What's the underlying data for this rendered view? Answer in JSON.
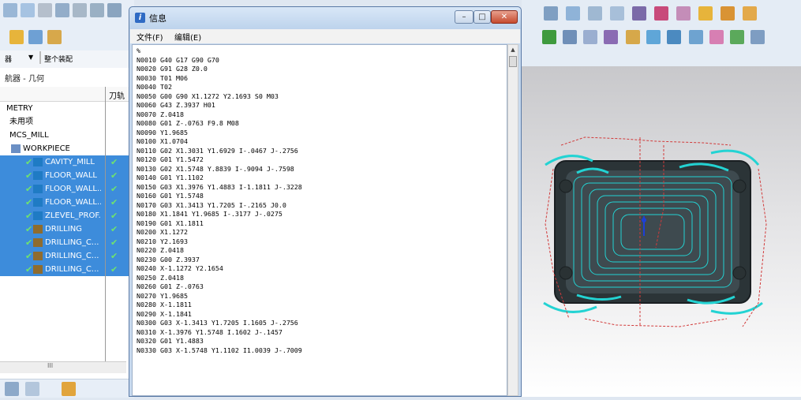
{
  "info_window": {
    "title": "信息",
    "menus": [
      "文件(F)",
      "编辑(E)"
    ],
    "buttons": {
      "minimize": "–",
      "maximize": "□",
      "close": "✕"
    },
    "code_lines": [
      "%",
      "N0010 G40 G17 G90 G70",
      "N0020 G91 G28 Z0.0",
      "N0030 T01 M06",
      "N0040 T02",
      "N0050 G00 G90 X1.1272 Y2.1693 S0 M03",
      "N0060 G43 Z.3937 H01",
      "N0070 Z.0418",
      "N0080 G01 Z-.0763 F9.8 M08",
      "N0090 Y1.9685",
      "N0100 X1.0704",
      "N0110 G02 X1.3031 Y1.6929 I-.0467 J-.2756",
      "N0120 G01 Y1.5472",
      "N0130 G02 X1.5748 Y.8839 I-.9094 J-.7598",
      "N0140 G01 Y1.1102",
      "N0150 G03 X1.3976 Y1.4883 I-1.1811 J-.3228",
      "N0160 G01 Y1.5748",
      "N0170 G03 X1.3413 Y1.7205 I-.2165 J0.0",
      "N0180 X1.1841 Y1.9685 I-.3177 J-.0275",
      "N0190 G01 X1.1811",
      "N0200 X1.1272",
      "N0210 Y2.1693",
      "N0220 Z.0418",
      "N0230 G00 Z.3937",
      "N0240 X-1.1272 Y2.1654",
      "N0250 Z.0418",
      "N0260 G01 Z-.0763",
      "N0270 Y1.9685",
      "N0280 X-1.1811",
      "N0290 X-1.1841",
      "N0300 G03 X-1.3413 Y1.7205 I.1605 J-.2756",
      "N0310 X-1.3976 Y1.5748 I.1602 J-.1457",
      "N0320 G01 Y1.4883",
      "N0330 G03 X-1.5748 Y1.1102 I1.0039 J-.7009"
    ]
  },
  "navigator": {
    "filter_left": "器",
    "filter_value": "整个装配",
    "title": "航器 - 几何",
    "column_header": "刀轨",
    "tree": [
      {
        "label": "METRY",
        "indent": 8,
        "selected": false,
        "icon": "none",
        "check": false
      },
      {
        "label": "未用项",
        "indent": 12,
        "selected": false,
        "icon": "none",
        "check": false
      },
      {
        "label": "MCS_MILL",
        "indent": 12,
        "selected": false,
        "icon": "none",
        "check": false
      },
      {
        "label": "WORKPIECE",
        "indent": 14,
        "selected": false,
        "icon": "workpiece-icon",
        "check": false
      },
      {
        "label": "CAVITY_MILL",
        "indent": 32,
        "selected": true,
        "icon": "mill-icon",
        "check": true
      },
      {
        "label": "FLOOR_WALL",
        "indent": 32,
        "selected": true,
        "icon": "mill-icon",
        "check": true
      },
      {
        "label": "FLOOR_WALL...",
        "indent": 32,
        "selected": true,
        "icon": "mill-icon",
        "check": true
      },
      {
        "label": "FLOOR_WALL...",
        "indent": 32,
        "selected": true,
        "icon": "mill-icon",
        "check": true
      },
      {
        "label": "ZLEVEL_PROF...",
        "indent": 32,
        "selected": true,
        "icon": "mill-icon",
        "check": true
      },
      {
        "label": "DRILLING",
        "indent": 32,
        "selected": true,
        "icon": "drill-icon",
        "check": true
      },
      {
        "label": "DRILLING_C...",
        "indent": 32,
        "selected": true,
        "icon": "drill-icon",
        "check": true
      },
      {
        "label": "DRILLING_C...",
        "indent": 32,
        "selected": true,
        "icon": "drill-icon",
        "check": true
      },
      {
        "label": "DRILLING_C...",
        "indent": 32,
        "selected": true,
        "icon": "drill-icon",
        "check": true
      }
    ],
    "scroll_label": "III"
  },
  "colors": {
    "selection": "#3d8cdb",
    "check": "#2ea02e",
    "toolpath": "#23d3d3",
    "part": "#3e4a4f"
  }
}
